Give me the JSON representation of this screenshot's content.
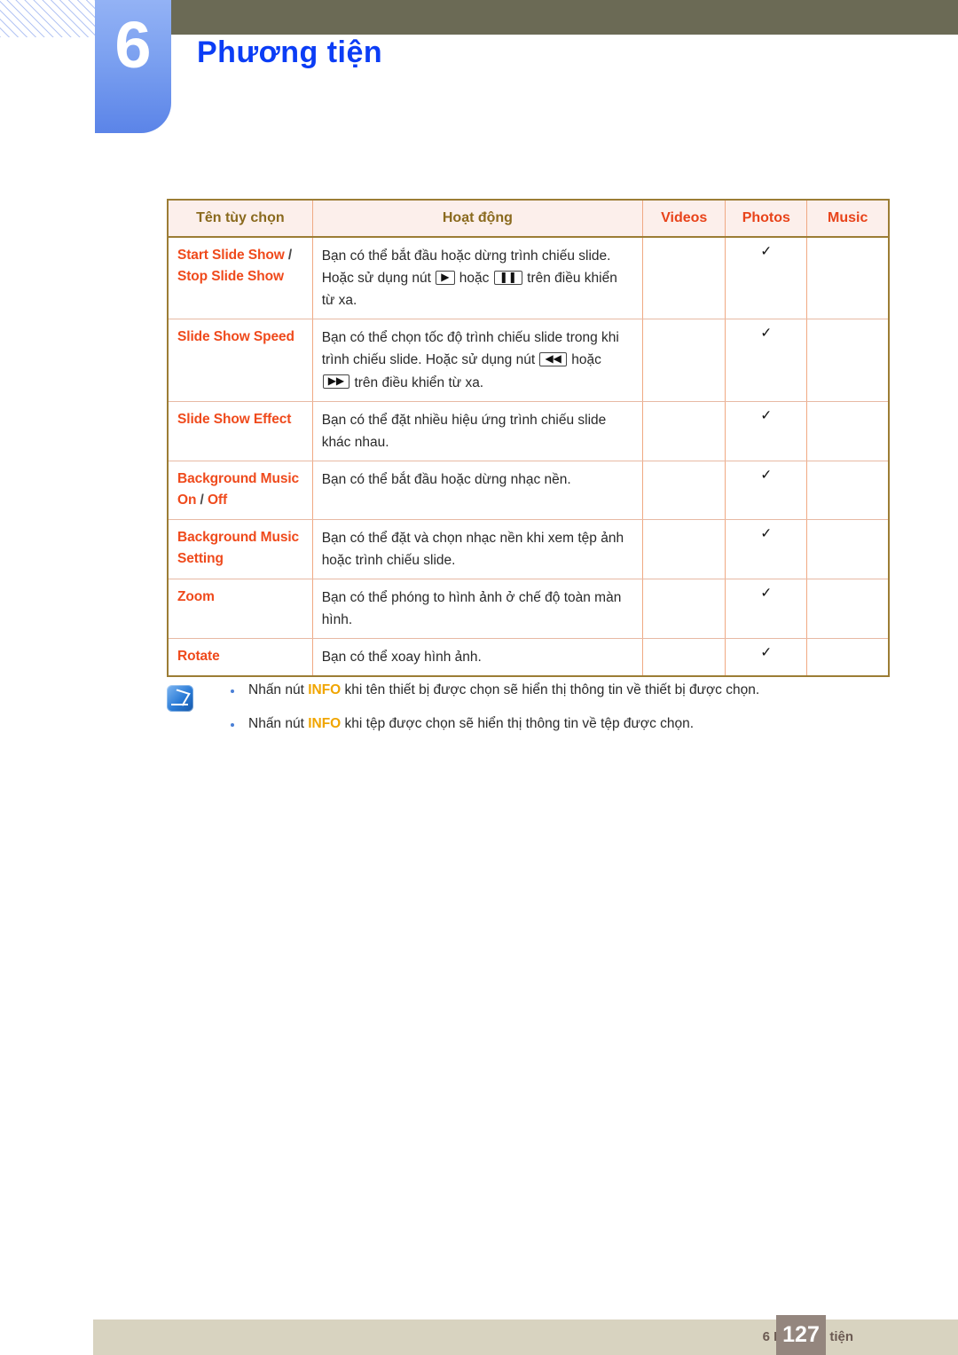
{
  "header": {
    "chapter_number": "6",
    "chapter_title": "Phương tiện"
  },
  "table": {
    "columns": [
      {
        "label": "Tên tùy chọn",
        "style": "brown"
      },
      {
        "label": "Hoạt động",
        "style": "brown"
      },
      {
        "label": "Videos",
        "style": "red"
      },
      {
        "label": "Photos",
        "style": "red"
      },
      {
        "label": "Music",
        "style": "red"
      }
    ],
    "rows": [
      {
        "name_part1": "Start Slide Show",
        "name_sep": " / ",
        "name_part2": "Stop Slide Show",
        "desc_a": "Bạn có thể bắt đầu hoặc dừng trình chiếu slide. Hoặc sử dụng nút ",
        "key1": "▶",
        "desc_b": " hoặc ",
        "key2": "❚❚",
        "desc_c": " trên điều khiển từ xa.",
        "videos": "",
        "photos": "✓",
        "music": ""
      },
      {
        "name_part1": "Slide Show Speed",
        "name_sep": "",
        "name_part2": "",
        "desc_a": "Bạn có thể chọn tốc độ trình chiếu slide trong khi trình chiếu slide. Hoặc sử dụng nút ",
        "key1": "◀◀",
        "desc_b": " hoặc ",
        "key2": "▶▶",
        "desc_c": " trên điều khiển từ xa.",
        "videos": "",
        "photos": "✓",
        "music": ""
      },
      {
        "name_part1": "Slide Show Effect",
        "name_sep": "",
        "name_part2": "",
        "desc_a": "Bạn có thể đặt nhiều hiệu ứng trình chiếu slide khác nhau.",
        "key1": "",
        "desc_b": "",
        "key2": "",
        "desc_c": "",
        "videos": "",
        "photos": "✓",
        "music": ""
      },
      {
        "name_part1": "Background Music On",
        "name_sep": " / ",
        "name_part2": "Off",
        "desc_a": "Bạn có thể bắt đầu hoặc dừng nhạc nền.",
        "key1": "",
        "desc_b": "",
        "key2": "",
        "desc_c": "",
        "videos": "",
        "photos": "✓",
        "music": ""
      },
      {
        "name_part1": "Background Music Setting",
        "name_sep": "",
        "name_part2": "",
        "desc_a": "Bạn có thể đặt và chọn nhạc nền khi xem tệp ảnh hoặc trình chiếu slide.",
        "key1": "",
        "desc_b": "",
        "key2": "",
        "desc_c": "",
        "videos": "",
        "photos": "✓",
        "music": ""
      },
      {
        "name_part1": "Zoom",
        "name_sep": "",
        "name_part2": "",
        "desc_a": "Bạn có thể phóng to hình ảnh ở chế độ toàn màn hình.",
        "key1": "",
        "desc_b": "",
        "key2": "",
        "desc_c": "",
        "videos": "",
        "photos": "✓",
        "music": ""
      },
      {
        "name_part1": "Rotate",
        "name_sep": "",
        "name_part2": "",
        "desc_a": "Bạn có thể xoay hình ảnh.",
        "key1": "",
        "desc_b": "",
        "key2": "",
        "desc_c": "",
        "videos": "",
        "photos": "✓",
        "music": ""
      }
    ]
  },
  "notes": [
    {
      "before": "Nhấn nút ",
      "keyword": "INFO",
      "after": " khi tên thiết bị được chọn sẽ hiển thị thông tin về thiết bị được chọn."
    },
    {
      "before": "Nhấn nút ",
      "keyword": "INFO",
      "after": " khi tệp được chọn sẽ hiển thị thông tin về tệp được chọn."
    }
  ],
  "footer": {
    "text": "6 Phương tiện",
    "page_number": "127"
  },
  "colors": {
    "accent_blue": "#0b3df5",
    "chapter_box": "#7ba0f0",
    "olive_bar": "#6b6a55",
    "table_border": "#9c7d35",
    "option_red": "#ef4a1c",
    "header_brown": "#8a6a1e",
    "footer_bar": "#d8d3c0",
    "page_badge": "#94867e",
    "info_gold": "#f0a500"
  }
}
